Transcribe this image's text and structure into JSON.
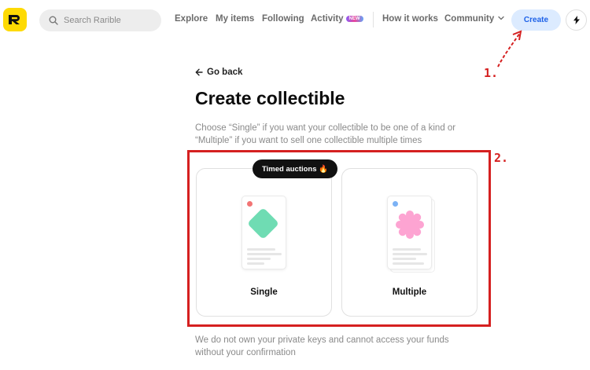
{
  "header": {
    "logo_letter": "R",
    "search": {
      "placeholder": "Search Rarible"
    },
    "nav": [
      {
        "label": "Explore"
      },
      {
        "label": "My items"
      },
      {
        "label": "Following"
      },
      {
        "label": "Activity",
        "badge": "NEW"
      },
      {
        "label": "How it works"
      },
      {
        "label": "Community"
      }
    ],
    "create_label": "Create",
    "bolt_icon": "lightning-icon"
  },
  "annotations": {
    "step1": "1.",
    "step2": "2.",
    "color": "#D52020"
  },
  "main": {
    "go_back": "Go back",
    "title": "Create collectible",
    "subtitle": "Choose “Single” if you want your collectible to be one of a kind or “Multiple” if you want to sell one collectible multiple times",
    "timed_badge": "Timed auctions 🔥",
    "cards": [
      {
        "label": "Single",
        "dot_color": "#F27474",
        "shape_color": "#6FDCB3"
      },
      {
        "label": "Multiple",
        "dot_color": "#7CB2F5",
        "shape_color": "#FDA4D2"
      }
    ],
    "disclaimer": "We do not own your private keys and cannot access your funds without your confirmation"
  },
  "colors": {
    "brand_yellow": "#FEDA03",
    "create_bg": "#DCEBFF",
    "create_text": "#1E62E8"
  }
}
